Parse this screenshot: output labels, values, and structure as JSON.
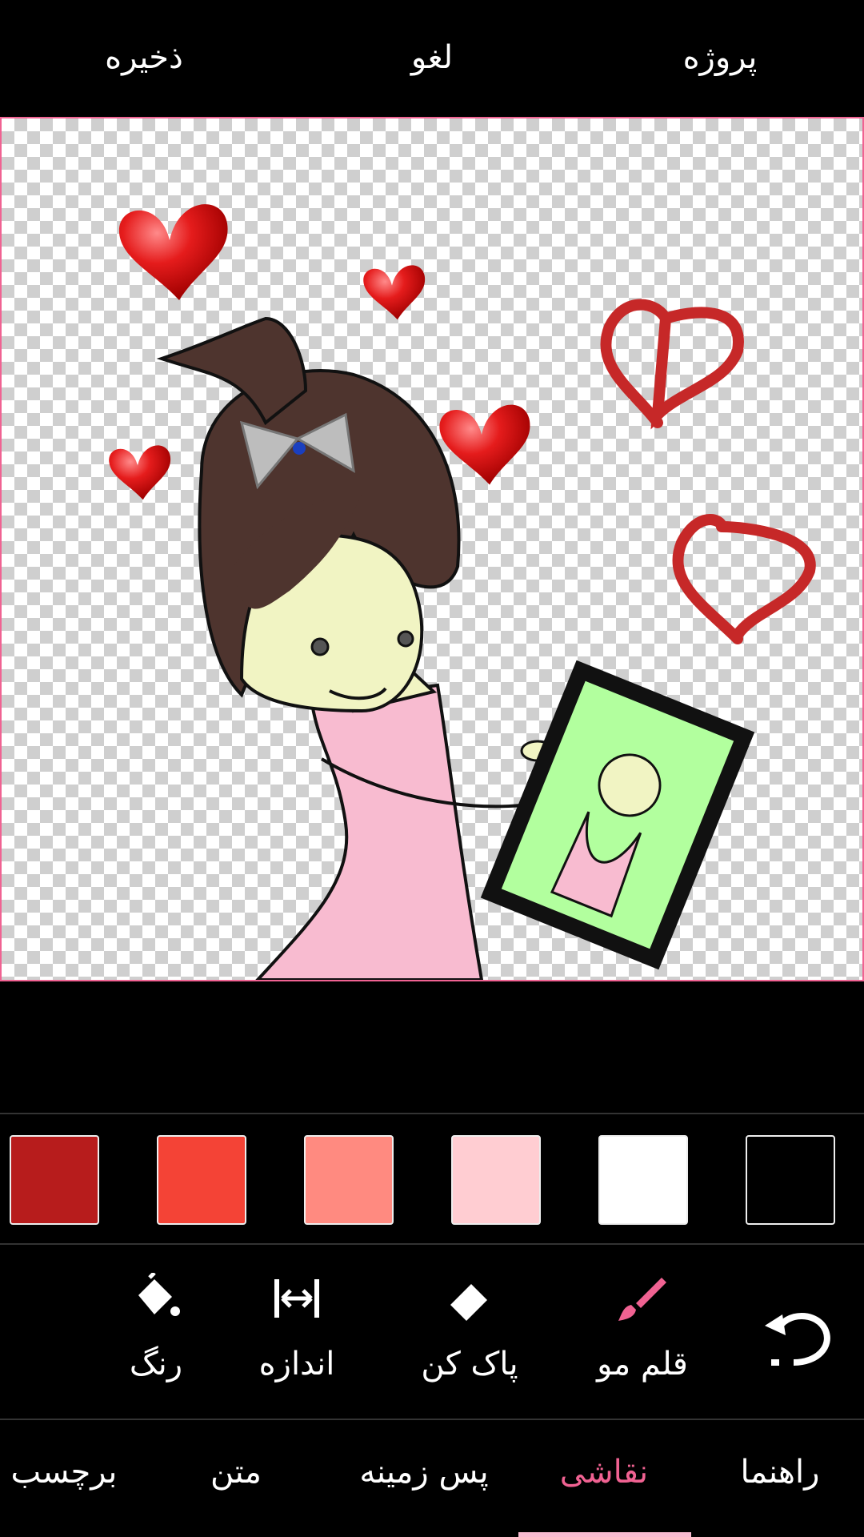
{
  "topbar": {
    "project_label": "پروژه",
    "cancel_label": "لغو",
    "save_label": "ذخیره"
  },
  "canvas": {
    "border_color": "#f06292",
    "background": "transparent-checkerboard"
  },
  "palette": {
    "colors": [
      "#b71c1c",
      "#f44336",
      "#ff8a80",
      "#ffcdd2",
      "#ffffff",
      "#000000"
    ]
  },
  "tools": {
    "brush_label": "قلم مو",
    "eraser_label": "پاک کن",
    "size_label": "اندازه",
    "color_label": "رنگ",
    "active_color": "#f06292",
    "icons": [
      "brush-icon",
      "eraser-icon",
      "resize-icon",
      "paint-bucket-icon",
      "undo-icon"
    ]
  },
  "nav": {
    "items": [
      "راهنما",
      "نقاشی",
      "پس زمینه",
      "متن",
      "برچسب"
    ],
    "active": "نقاشی"
  }
}
